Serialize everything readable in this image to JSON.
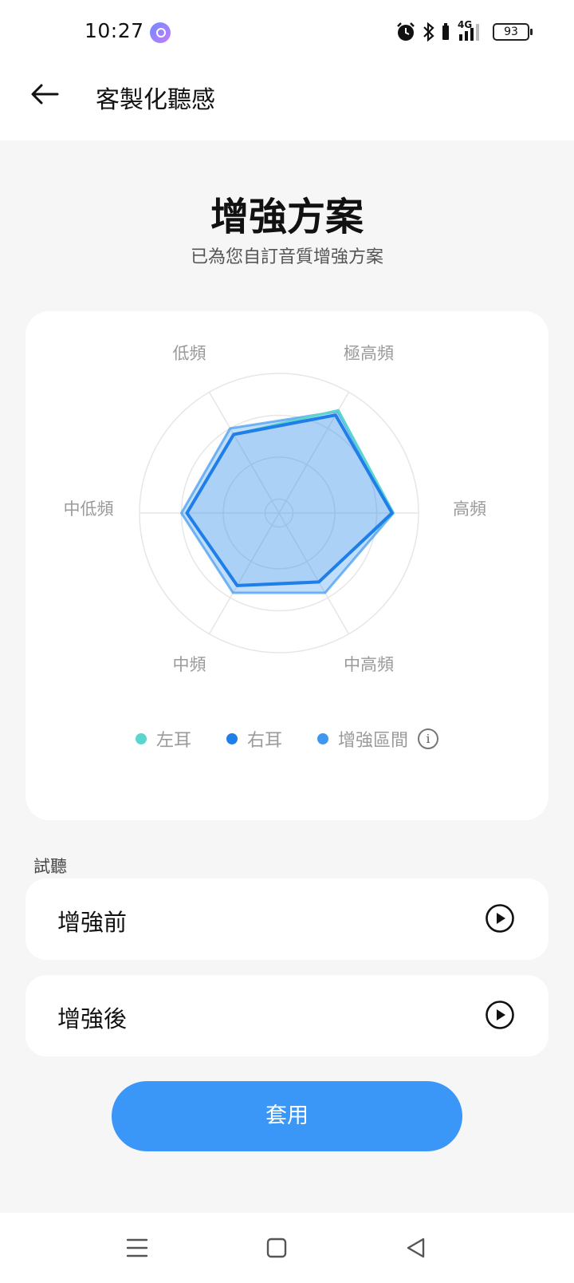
{
  "status_bar": {
    "time": "10:27",
    "network": "4G",
    "battery": "93",
    "icons": [
      "app-notification-icon",
      "alarm-icon",
      "bluetooth-icon",
      "signal-icon",
      "battery-icon"
    ]
  },
  "header": {
    "title": "客製化聽感",
    "back_icon": "back-arrow-icon"
  },
  "hero": {
    "title": "增強方案",
    "subtitle": "已為您自訂音質增強方案"
  },
  "chart_data": {
    "type": "radar",
    "axes": [
      "極高頻",
      "高頻",
      "中高頻",
      "中頻",
      "中低頻",
      "低頻"
    ],
    "range": [
      0,
      1
    ],
    "series": [
      {
        "name": "左耳",
        "values": [
          0.85,
          0.82,
          0.57,
          0.6,
          0.66,
          0.65
        ],
        "color": "#5ad6cf"
      },
      {
        "name": "右耳",
        "values": [
          0.81,
          0.81,
          0.57,
          0.6,
          0.66,
          0.65
        ],
        "color": "#1f7ee8"
      },
      {
        "name": "增強區間",
        "values": [
          0.84,
          0.82,
          0.66,
          0.66,
          0.7,
          0.7
        ],
        "color": "#3f98f0"
      }
    ],
    "gridlines": "concentric circles",
    "legend_position": "bottom"
  },
  "legend": {
    "left_ear": "左耳",
    "right_ear": "右耳",
    "enhanced_range": "增強區間",
    "info_icon": "info-icon",
    "info_glyph": "i"
  },
  "preview": {
    "section_label": "試聽",
    "before_label": "增強前",
    "after_label": "增強後",
    "play_icon": "play-icon"
  },
  "apply_button": "套用",
  "nav": {
    "items": [
      "menu-icon",
      "home-square-icon",
      "back-triangle-icon"
    ]
  },
  "colors": {
    "accent": "#3a97f7",
    "left_ear": "#5ad6cf",
    "right_ear": "#1f7ee8",
    "enhanced": "#3f98f0",
    "background": "#f6f6f6"
  }
}
